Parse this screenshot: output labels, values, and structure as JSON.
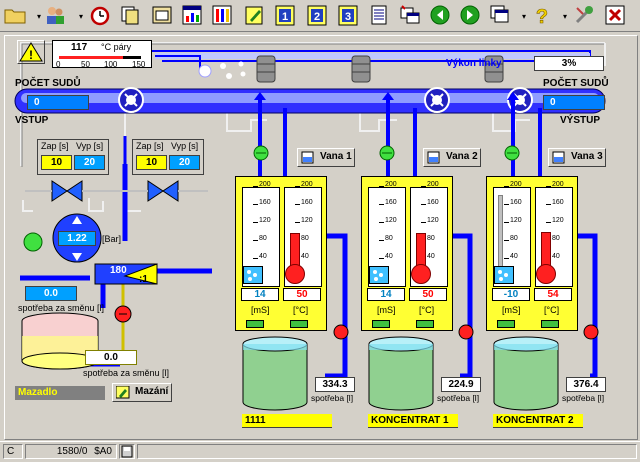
{
  "toolbar": {
    "buttons": [
      "folder-icon",
      "users-icon",
      "alarm-clock-icon",
      "copy-icon",
      "window-icon",
      "bar-chart-icon",
      "thermometer-chart-icon",
      "pencil-icon",
      "line-1-icon",
      "line-2-icon",
      "line-3-icon",
      "report-icon",
      "windows-icon",
      "back-icon",
      "forward-icon",
      "pages-icon",
      "help-icon",
      "tools-icon",
      "close-icon"
    ],
    "line_labels": [
      "1",
      "2",
      "3"
    ]
  },
  "steam": {
    "value": "117",
    "unit": "°C páry",
    "ticks": [
      "0",
      "50",
      "100",
      "150"
    ]
  },
  "output": {
    "label": "Výkon linky",
    "value": "3%"
  },
  "counters": {
    "left_title": "POČET SUDŮ",
    "left_value": "0",
    "left_sub": "VSTUP",
    "right_title": "POČET SUDŮ",
    "right_value": "0",
    "right_sub": "VÝSTUP"
  },
  "timers": [
    {
      "zap_label": "Zap [s]",
      "vyp_label": "Vyp [s]",
      "zap": "10",
      "vyp": "20"
    },
    {
      "zap_label": "Zap [s]",
      "vyp_label": "Vyp [s]",
      "zap": "10",
      "vyp": "20"
    }
  ],
  "pressure": {
    "value": "1.22",
    "unit": "[Bar]"
  },
  "mixer": {
    "value": "180",
    "ratio": ":1"
  },
  "consumption_shift": {
    "value": "0.0",
    "label": "spotřeba za směnu [l]"
  },
  "consumption_shift2": {
    "value": "0.0",
    "label": "spotřeba za směnu [l]"
  },
  "mazadlo": {
    "label": "Mazadlo",
    "button": "Mazání"
  },
  "tanks": [
    {
      "button": "Vana 1",
      "scale": [
        "200",
        "160",
        "120",
        "80",
        "40",
        "0"
      ],
      "cond": "14",
      "temp": "50",
      "cond_unit": "[mS]",
      "temp_unit": "[°C]",
      "cond_level": 0.1,
      "temp_level": 0.25,
      "spotreba_value": "334.3",
      "spotreba_label": "spotřeba [l]",
      "name": "1111"
    },
    {
      "button": "Vana 2",
      "scale": [
        "200",
        "160",
        "120",
        "80",
        "40",
        "0"
      ],
      "cond": "14",
      "temp": "50",
      "cond_unit": "[mS]",
      "temp_unit": "[°C]",
      "cond_level": 0.1,
      "temp_level": 0.25,
      "spotreba_value": "224.9",
      "spotreba_label": "spotřeba [l]",
      "name": "KONCENTRAT 1"
    },
    {
      "button": "Vana 3",
      "scale": [
        "200",
        "160",
        "120",
        "80",
        "40",
        "0"
      ],
      "cond": "-10",
      "temp": "54",
      "cond_unit": "[mS]",
      "temp_unit": "[°C]",
      "cond_level": 0.9,
      "temp_level": 0.27,
      "spotreba_value": "376.4",
      "spotreba_label": "spotřeba [l]",
      "name": "KONCENTRAT 2"
    }
  ],
  "status": {
    "mode": "C",
    "counter": "1580/0",
    "code": "$A0"
  },
  "colors": {
    "pipe": "#0000ff",
    "tank_frame": "#ffff33",
    "value_bg": "#0080ff",
    "liquid": "#8fd08f"
  }
}
